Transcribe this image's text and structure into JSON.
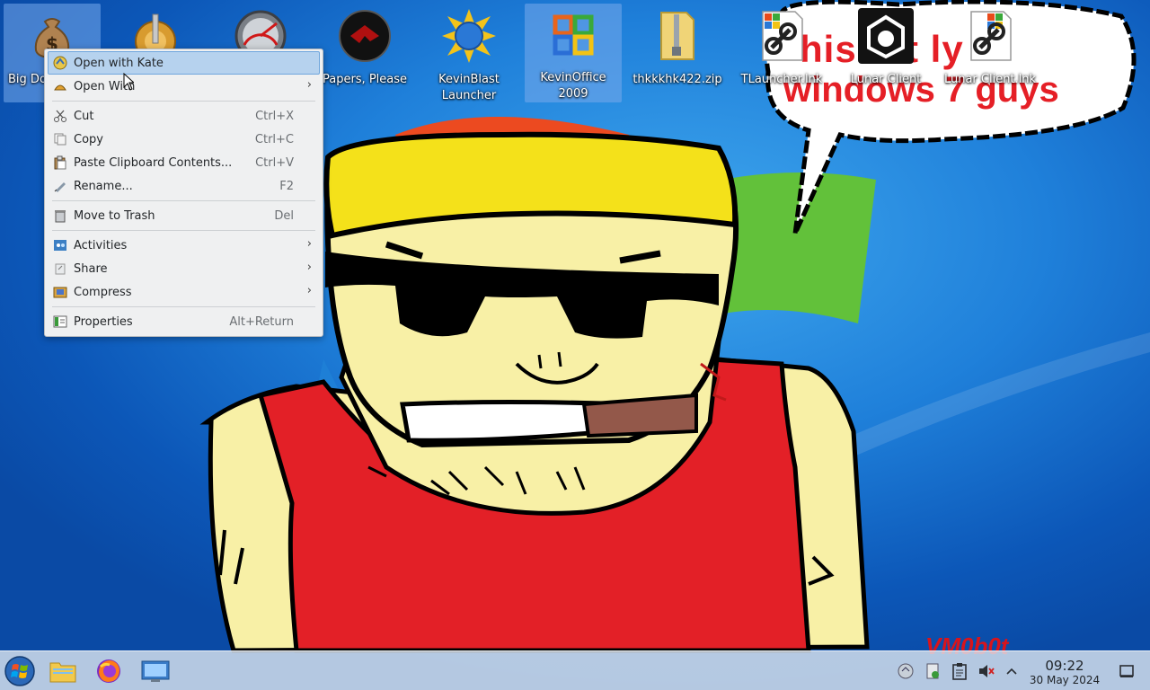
{
  "wallpaper": {
    "speech_line1": "his   tot  ly",
    "speech_line2": "windows 7 guys",
    "signature": "VM0b0t"
  },
  "desktop_icons": [
    {
      "label": "Big Dollar De...",
      "icon": "money-bag-icon",
      "selected": true
    },
    {
      "label": "",
      "icon": "settings-dial-icon",
      "selected": false
    },
    {
      "label": "",
      "icon": "speedometer-icon",
      "selected": false
    },
    {
      "label": "Papers, Please",
      "icon": "papers-please-icon",
      "selected": false
    },
    {
      "label": "KevinBlast Launcher",
      "icon": "kevinblast-launcher-icon",
      "selected": false
    },
    {
      "label": "KevinOffice 2009",
      "icon": "kevinoffice-icon",
      "selected": true
    },
    {
      "label": "thkkkhk422.zip",
      "icon": "zip-folder-icon",
      "selected": false
    },
    {
      "label": "TLauncher.lnk",
      "icon": "shortcut-link-icon",
      "selected": false
    },
    {
      "label": "Lunar Client",
      "icon": "lunar-client-icon",
      "selected": false
    },
    {
      "label": "Lunar Client.lnk",
      "icon": "shortcut-link-icon",
      "selected": false
    }
  ],
  "context_menu": {
    "items": [
      {
        "label": "Open with Kate",
        "shortcut": "",
        "icon": "kate-icon"
      },
      {
        "label": "Open With",
        "shortcut": "",
        "icon": "open-with-icon",
        "submenu": true
      },
      {
        "label": "Cut",
        "shortcut": "Ctrl+X",
        "icon": "scissors-icon"
      },
      {
        "label": "Copy",
        "shortcut": "Ctrl+C",
        "icon": "copy-icon"
      },
      {
        "label": "Paste Clipboard Contents...",
        "shortcut": "Ctrl+V",
        "icon": "paste-icon"
      },
      {
        "label": "Rename...",
        "shortcut": "F2",
        "icon": "rename-icon"
      },
      {
        "label": "Move to Trash",
        "shortcut": "Del",
        "icon": "trash-icon"
      },
      {
        "label": "Activities",
        "shortcut": "",
        "icon": "activities-icon",
        "submenu": true
      },
      {
        "label": "Share",
        "shortcut": "",
        "icon": "share-icon",
        "submenu": true
      },
      {
        "label": "Compress",
        "shortcut": "",
        "icon": "compress-icon",
        "submenu": true
      },
      {
        "label": "Properties",
        "shortcut": "Alt+Return",
        "icon": "properties-icon"
      }
    ],
    "submenu_arrow": "›"
  },
  "taskbar": {
    "apps": [
      "start-menu-icon",
      "file-manager-icon",
      "firefox-icon",
      "system-settings-icon"
    ],
    "tray": [
      "network-icon",
      "updates-icon",
      "clipboard-icon",
      "volume-muted-icon",
      "tray-expand-icon"
    ],
    "clock_time": "09:22",
    "clock_date": "30 May 2024"
  }
}
